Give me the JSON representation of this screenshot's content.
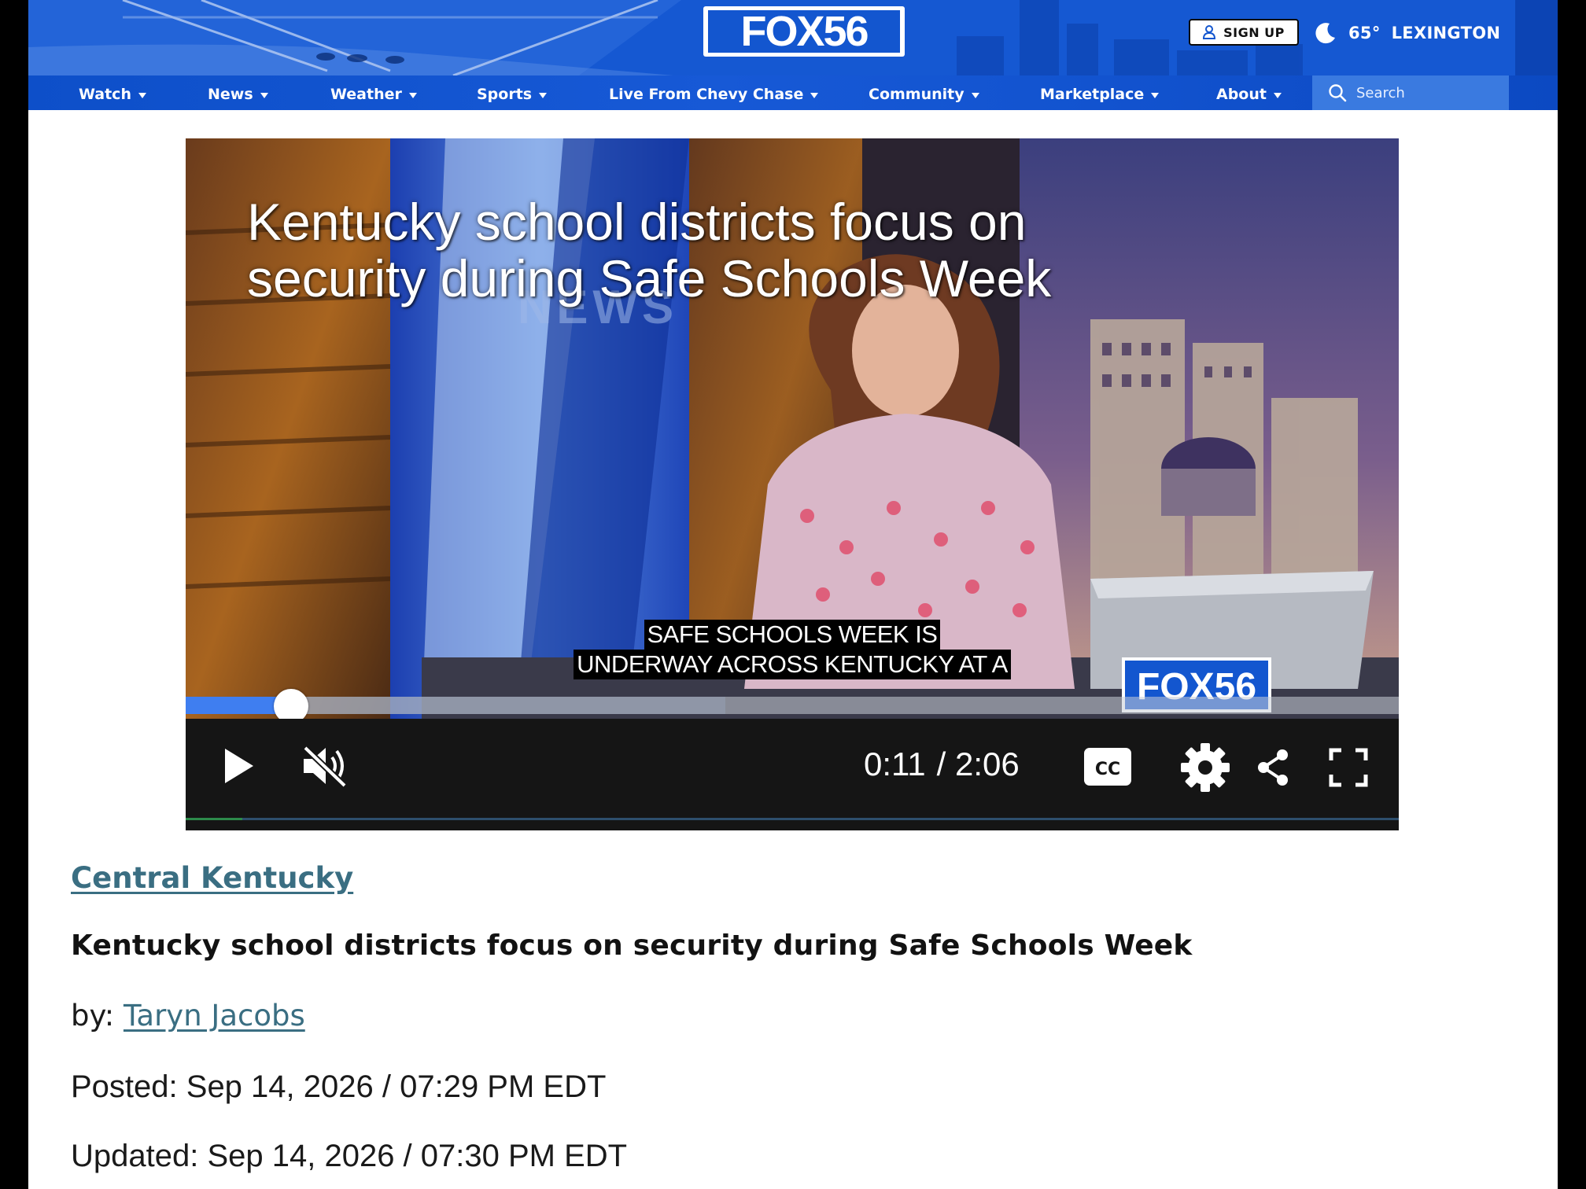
{
  "header": {
    "logo_text": "FOX56",
    "signup_label": "SIGN UP",
    "weather": {
      "temp": "65°",
      "location": "LEXINGTON",
      "icon": "moon-icon"
    },
    "search_placeholder": "Search",
    "colors": {
      "brand_blue": "#1356cf",
      "search_bg": "#3a7ae0"
    }
  },
  "nav": {
    "items": [
      {
        "label": "Watch"
      },
      {
        "label": "News"
      },
      {
        "label": "Weather"
      },
      {
        "label": "Sports"
      },
      {
        "label": "Live From Chevy Chase"
      },
      {
        "label": "Community"
      },
      {
        "label": "Marketplace"
      },
      {
        "label": "About"
      }
    ]
  },
  "video": {
    "title_overlay_line1": "Kentucky school districts focus on",
    "title_overlay_line2": "security during Safe Schools Week",
    "caption_line1": "SAFE SCHOOLS WEEK IS",
    "caption_line2": "UNDERWAY ACROSS KENTUCKY AT A",
    "current_time": "0:11",
    "duration": "/ 2:06",
    "progress_fraction": 0.087,
    "buffered_fraction": 0.445,
    "desk_logo": "FOX56",
    "backdrop_text": "NEWS",
    "colors": {
      "progress": "#3f7ef0",
      "controls_bg": "#151515"
    }
  },
  "article": {
    "category": "Central Kentucky",
    "headline": "Kentucky school districts focus on security during Safe Schools Week",
    "by_prefix": "by:",
    "author": "Taryn Jacobs",
    "posted": "Posted: Sep 14, 2026 / 07:29 PM EDT",
    "updated": "Updated: Sep 14, 2026 / 07:30 PM EDT",
    "link_color": "#3a6e82"
  }
}
